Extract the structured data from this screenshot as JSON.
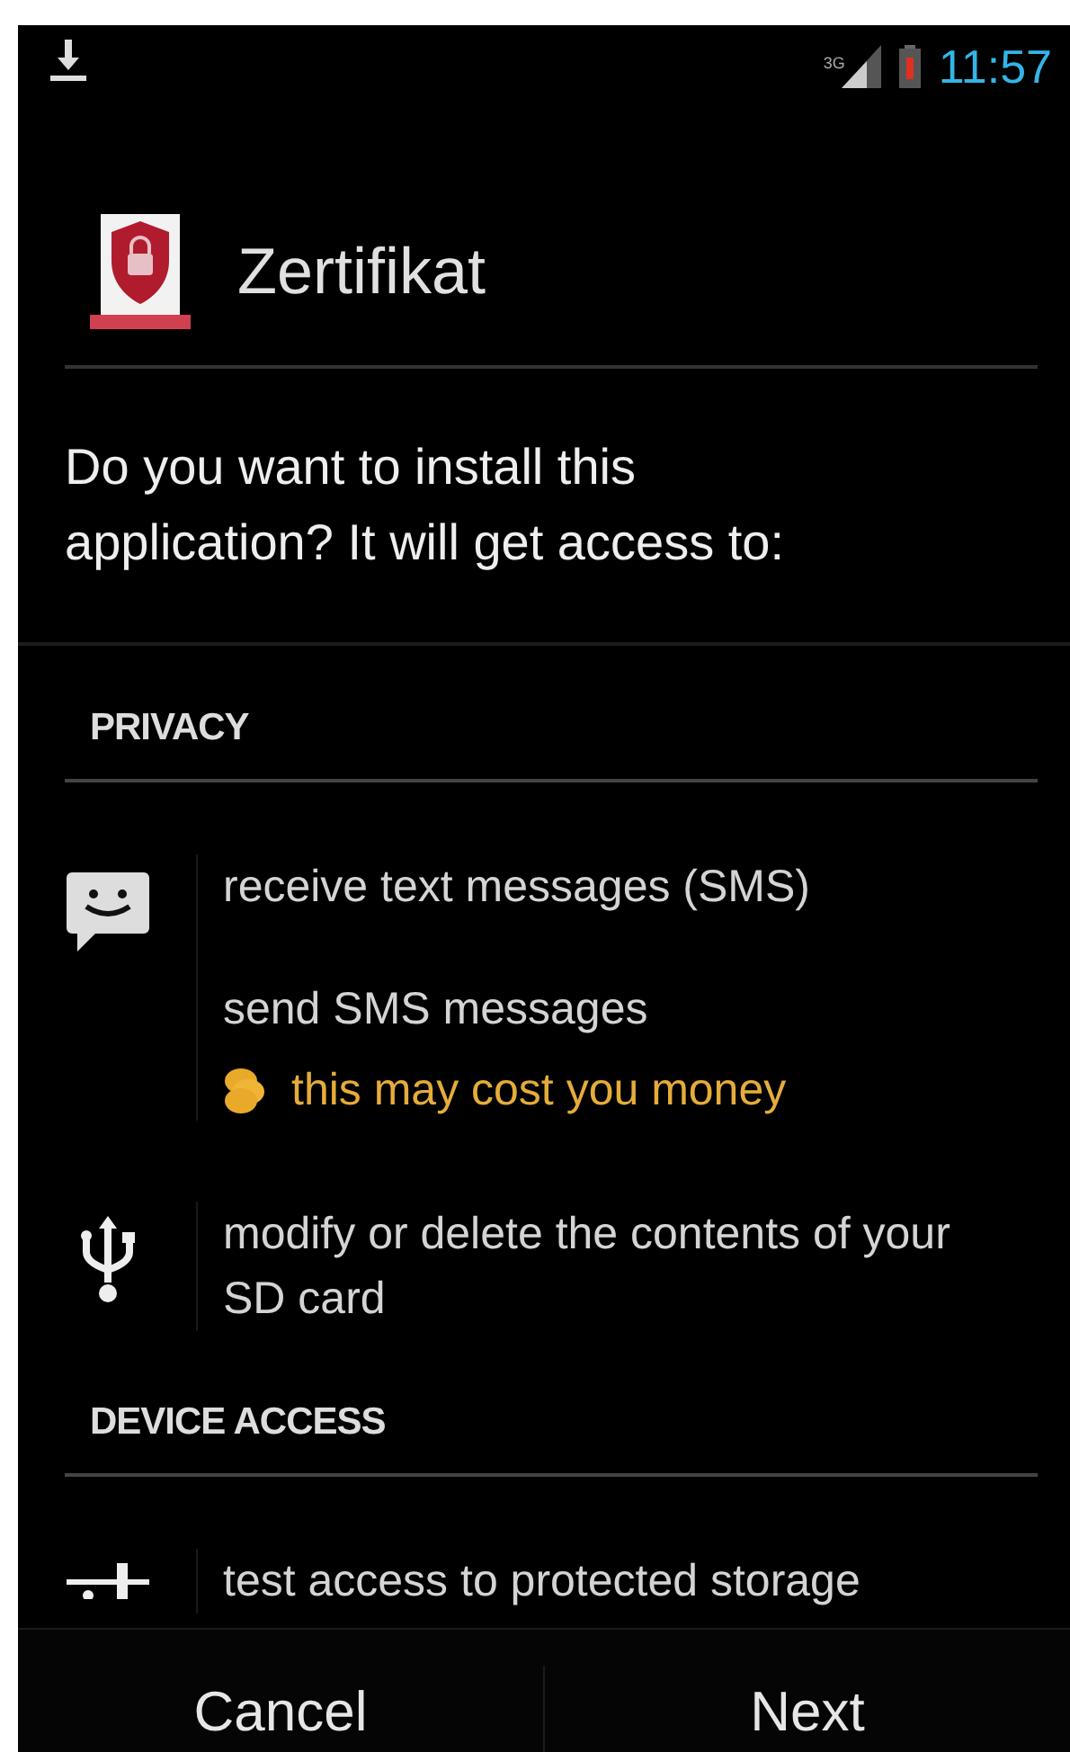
{
  "status_bar": {
    "network": "3G",
    "time": "11:57"
  },
  "app": {
    "name": "Zertifikat"
  },
  "prompt": "Do you want to install this application? It will get access to:",
  "sections": [
    {
      "title": "PRIVACY",
      "permissions": [
        {
          "kind": "sms",
          "lines": [
            {
              "kind": "plain",
              "text": "receive text messages (SMS)"
            },
            {
              "kind": "plain",
              "text": "send SMS messages"
            },
            {
              "kind": "cost",
              "text": "this may cost you money"
            }
          ]
        },
        {
          "kind": "usb",
          "lines": [
            {
              "kind": "plain",
              "text": "modify or delete the contents of your SD card"
            }
          ]
        }
      ]
    },
    {
      "title": "DEVICE ACCESS",
      "permissions": [
        {
          "kind": "storage",
          "lines": [
            {
              "kind": "plain",
              "text": "test access to protected storage"
            }
          ]
        }
      ]
    }
  ],
  "buttons": [
    {
      "label": "Cancel"
    },
    {
      "label": "Next"
    }
  ]
}
